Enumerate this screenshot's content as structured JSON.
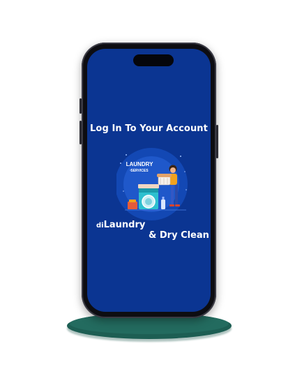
{
  "screen": {
    "title": "Log In To Your Account",
    "badge_line1": "LAUNDRY",
    "badge_line2": "SERVICES",
    "brand_prefix": "di",
    "brand_main": "Laundry",
    "brand_line2": "& Dry Clean"
  },
  "colors": {
    "screen_bg": "#0b3592",
    "stand": "#1d5e53",
    "phone_frame": "#0d0d12"
  }
}
